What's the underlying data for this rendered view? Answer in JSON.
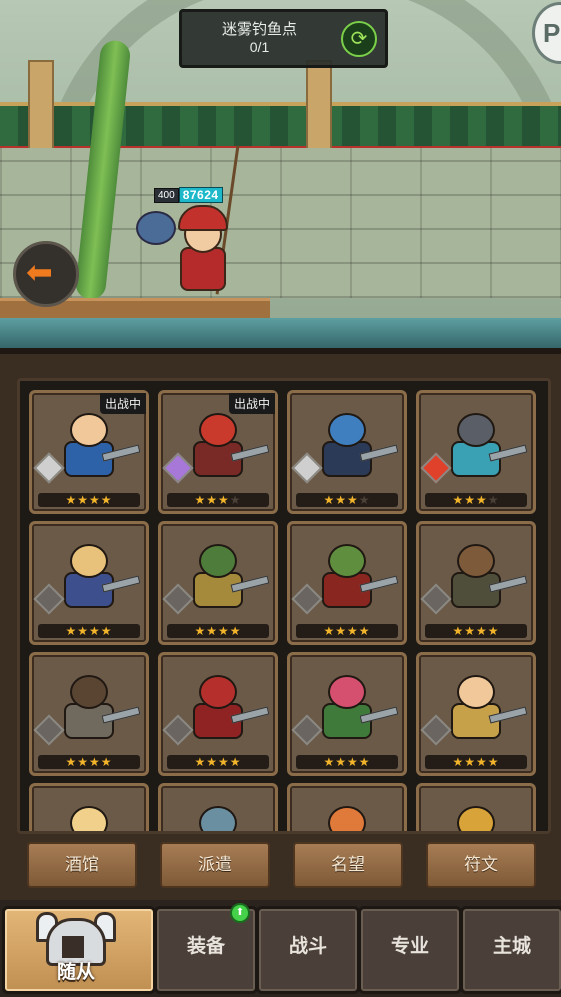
{
  "location": {
    "title": "迷雾钓鱼点",
    "progress": "0/1"
  },
  "player": {
    "level": "400",
    "hp": "87624"
  },
  "icons": {
    "refresh": "refresh-icon",
    "back": "back-arrow-icon",
    "corner": "profile-icon",
    "helmet": "helmet-icon",
    "gem": "rune-gem-icon",
    "star": "star-icon"
  },
  "cards": [
    {
      "name": "hero-1",
      "stars": 4,
      "badge": "出战中",
      "head": "#f0c89a",
      "body": "#2d61a8",
      "gem": "#cfcfcf"
    },
    {
      "name": "hero-2",
      "stars": 3,
      "badge": "出战中",
      "head": "#c93a2d",
      "body": "#7a2a26",
      "gem": "#a778d8"
    },
    {
      "name": "hero-3",
      "stars": 3,
      "badge": "",
      "head": "#3f7fbf",
      "body": "#2b3a56",
      "gem": "#cfcfcf"
    },
    {
      "name": "hero-4",
      "stars": 3,
      "badge": "",
      "head": "#5a5e66",
      "body": "#3aa0b3",
      "gem": "#e0412b"
    },
    {
      "name": "hero-5",
      "stars": 4,
      "badge": "",
      "head": "#e8c27a",
      "body": "#3d4f8d",
      "gem": "#6a6560"
    },
    {
      "name": "hero-6",
      "stars": 4,
      "badge": "",
      "head": "#4e7d3b",
      "body": "#a58a3c",
      "gem": "#6a6560"
    },
    {
      "name": "hero-7",
      "stars": 4,
      "badge": "",
      "head": "#5f8f3e",
      "body": "#8a2620",
      "gem": "#6a6560"
    },
    {
      "name": "hero-8",
      "stars": 4,
      "badge": "",
      "head": "#7c5a3a",
      "body": "#4f4e3a",
      "gem": "#6a6560"
    },
    {
      "name": "hero-9",
      "stars": 4,
      "badge": "",
      "head": "#5a4532",
      "body": "#706a5e",
      "gem": "#6a6560"
    },
    {
      "name": "hero-10",
      "stars": 4,
      "badge": "",
      "head": "#b5302d",
      "body": "#8f2323",
      "gem": "#6a6560"
    },
    {
      "name": "hero-11",
      "stars": 4,
      "badge": "",
      "head": "#d4506e",
      "body": "#3f7a3a",
      "gem": "#6a6560"
    },
    {
      "name": "hero-12",
      "stars": 4,
      "badge": "",
      "head": "#f0c89a",
      "body": "#c7a04a",
      "gem": "#6a6560"
    },
    {
      "name": "hero-13",
      "stars": 0,
      "badge": "",
      "head": "#f0d08a",
      "body": "#6b5a48",
      "gem": "#6a6560"
    },
    {
      "name": "hero-14",
      "stars": 0,
      "badge": "",
      "head": "#6a8fa0",
      "body": "#6b5a48",
      "gem": "#6a6560"
    },
    {
      "name": "hero-15",
      "stars": 0,
      "badge": "",
      "head": "#e07a3a",
      "body": "#6b5a48",
      "gem": "#6a6560"
    },
    {
      "name": "hero-16",
      "stars": 0,
      "badge": "",
      "head": "#d8a43a",
      "body": "#6b5a48",
      "gem": "#6a6560"
    }
  ],
  "subtabs": [
    "酒馆",
    "派遣",
    "名望",
    "符文"
  ],
  "nav": {
    "active": "随从",
    "items": [
      "装备",
      "战斗",
      "专业",
      "主城"
    ]
  }
}
